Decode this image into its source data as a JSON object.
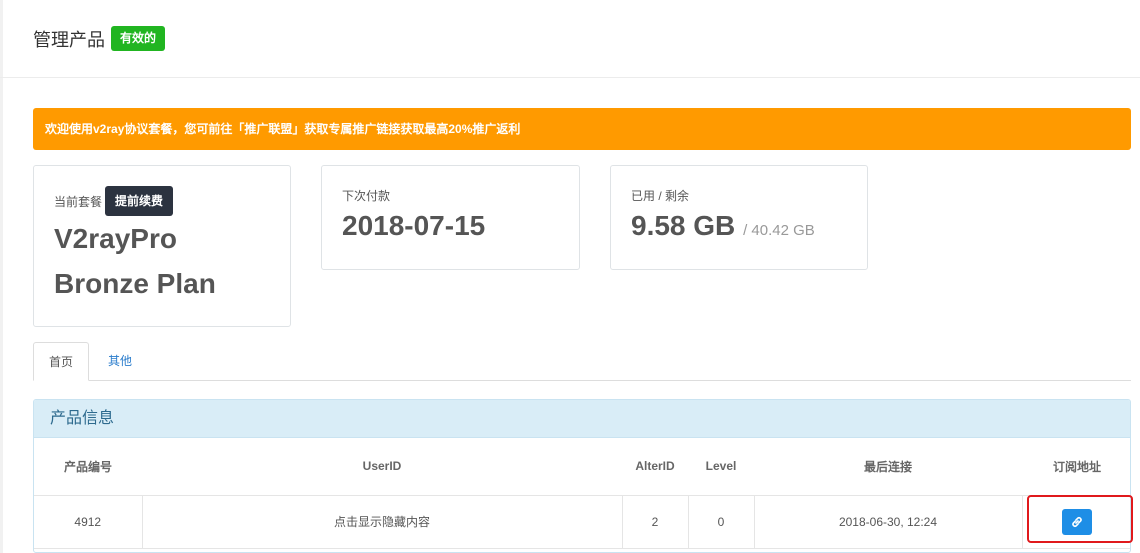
{
  "header": {
    "title": "管理产品",
    "status": "有效的"
  },
  "alert": {
    "text": "欢迎使用v2ray协议套餐，您可前往「推广联盟」获取专属推广链接获取最高20%推广返利"
  },
  "cards": {
    "plan": {
      "label": "当前套餐",
      "renew_label": "提前续费",
      "name_line1": "V2rayPro",
      "name_line2": "Bronze Plan"
    },
    "payment": {
      "label": "下次付款",
      "date": "2018-07-15"
    },
    "usage": {
      "label": "已用 / 剩余",
      "used": "9.58 GB",
      "total": "/ 40.42 GB"
    }
  },
  "tabs": [
    {
      "label": "首页"
    },
    {
      "label": "其他"
    }
  ],
  "panel": {
    "title": "产品信息",
    "columns": [
      "产品编号",
      "UserID",
      "AlterID",
      "Level",
      "最后连接",
      "订阅地址"
    ],
    "rows": [
      {
        "id": "4912",
        "userid": "点击显示隐藏内容",
        "alterid": "2",
        "level": "0",
        "last_connect": "2018-06-30, 12:24",
        "subscribe_icon": "link-icon"
      }
    ]
  },
  "colors": {
    "success": "#21b521",
    "warning": "#ff9a00",
    "primary": "#1e8ee6",
    "dark": "#2c3340",
    "highlight": "#e0191c"
  }
}
